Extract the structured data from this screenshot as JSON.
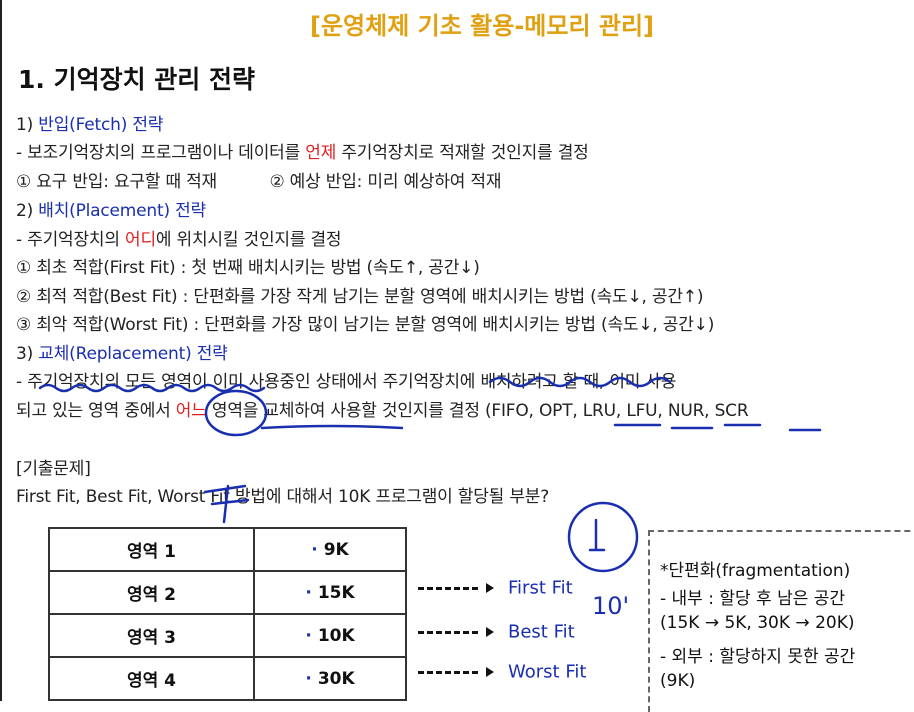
{
  "header": "[운영체제 기초 활용-메모리 관리]",
  "title": "1. 기억장치 관리 전략",
  "lines": {
    "s1_num": "1)",
    "s1_label": "반입(Fetch) 전략",
    "s1_desc_a": "- 보조기억장치의 프로그램이나 데이터를",
    "s1_desc_red": "언제",
    "s1_desc_b": "주기억장치로 적재할 것인지를 결정",
    "s1_items_a": "① 요구 반입: 요구할 때 적재",
    "s1_items_b": "② 예상 반입: 미리 예상하여 적재",
    "s2_num": "2)",
    "s2_label": "배치(Placement) 전략",
    "s2_desc_a": "- 주기억장치의",
    "s2_desc_red": "어디",
    "s2_desc_b": "에 위치시킬 것인지를 결정",
    "s2_item1": "① 최초 적합(First Fit) : 첫 번째 배치시키는 방법 (속도↑, 공간↓)",
    "s2_item2": "② 최적 적합(Best Fit) : 단편화를 가장 작게 남기는 분할 영역에 배치시키는 방법 (속도↓, 공간↑)",
    "s2_item3": "③ 최악 적합(Worst Fit) : 단편화를 가장 많이 남기는 분할 영역에 배치시키는 방법 (속도↓, 공간↓)",
    "s3_num": "3)",
    "s3_label": "교체(Replacement) 전략",
    "s3_desc1": "- 주기억장치의 모든 영역이 이미 사용중인 상태에서 주기억장치에 배치하려고 할 때, 이미 사용",
    "s3_desc2_a": "되고 있는 영역 중에서",
    "s3_desc2_red": "어느",
    "s3_desc2_b": "영역을 교체하여 사용할 것인지를 결정 (FIFO, OPT, LRU, LFU, NUR, SCR",
    "exam_label": "[기출문제]",
    "exam_question": "First Fit, Best Fit, Worst Fit 방법에 대해서 10K 프로그램이 할당될 부분?"
  },
  "table": [
    {
      "region": "영역 1",
      "size": "9K"
    },
    {
      "region": "영역 2",
      "size": "15K"
    },
    {
      "region": "영역 3",
      "size": "10K"
    },
    {
      "region": "영역 4",
      "size": "30K"
    }
  ],
  "fits": [
    "First Fit",
    "Best Fit",
    "Worst Fit"
  ],
  "handwritten": {
    "circle_mark": "1",
    "ten_mark": "10'"
  },
  "frag": {
    "title": "*단편화(fragmentation)",
    "internal": "- 내부 : 할당 후 남은 공간",
    "internal_ex": "(15K → 5K, 30K → 20K)",
    "external": "- 외부 : 할당하지 못한 공간",
    "external_ex": "(9K)"
  },
  "colors": {
    "header": "#e0a010",
    "accent_blue": "#1a2fb0",
    "accent_red": "#e02020",
    "ink": "#1a2fb0"
  }
}
